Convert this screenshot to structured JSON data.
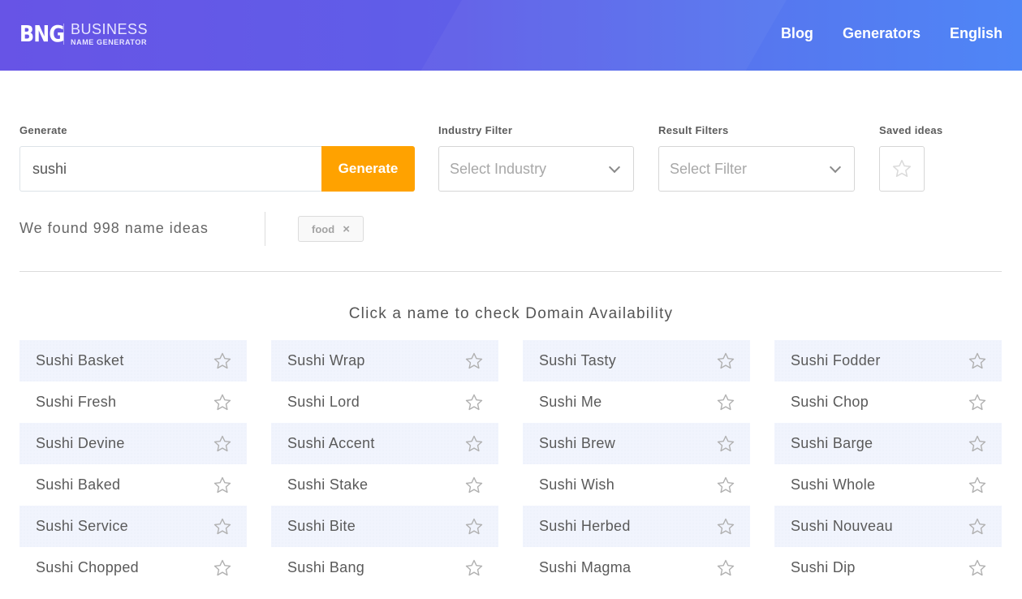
{
  "header": {
    "logo_mark": "BNG",
    "logo_line1": "BUSINESS",
    "logo_line2": "NAME GENERATOR",
    "nav": [
      "Blog",
      "Generators",
      "English"
    ]
  },
  "form": {
    "generate_label": "Generate",
    "query_value": "sushi",
    "generate_button": "Generate",
    "industry_label": "Industry Filter",
    "industry_placeholder": "Select Industry",
    "result_label": "Result Filters",
    "result_placeholder": "Select Filter",
    "saved_label": "Saved ideas"
  },
  "results": {
    "found_text": "We found 998 name ideas",
    "active_tag": "food",
    "tag_remove": "×",
    "hint": "Click a name to check Domain Availability",
    "columns": [
      [
        "Sushi Basket",
        "Sushi Fresh",
        "Sushi Devine",
        "Sushi Baked",
        "Sushi Service",
        "Sushi Chopped"
      ],
      [
        "Sushi Wrap",
        "Sushi Lord",
        "Sushi Accent",
        "Sushi Stake",
        "Sushi Bite",
        "Sushi Bang"
      ],
      [
        "Sushi Tasty",
        "Sushi Me",
        "Sushi Brew",
        "Sushi Wish",
        "Sushi Herbed",
        "Sushi Magma"
      ],
      [
        "Sushi Fodder",
        "Sushi Chop",
        "Sushi Barge",
        "Sushi Whole",
        "Sushi Nouveau",
        "Sushi Dip"
      ]
    ]
  },
  "colors": {
    "accent": "#ffa200",
    "header_start": "#6754e6",
    "header_end": "#4f86f6",
    "row_shade": "#f1f4fd"
  }
}
